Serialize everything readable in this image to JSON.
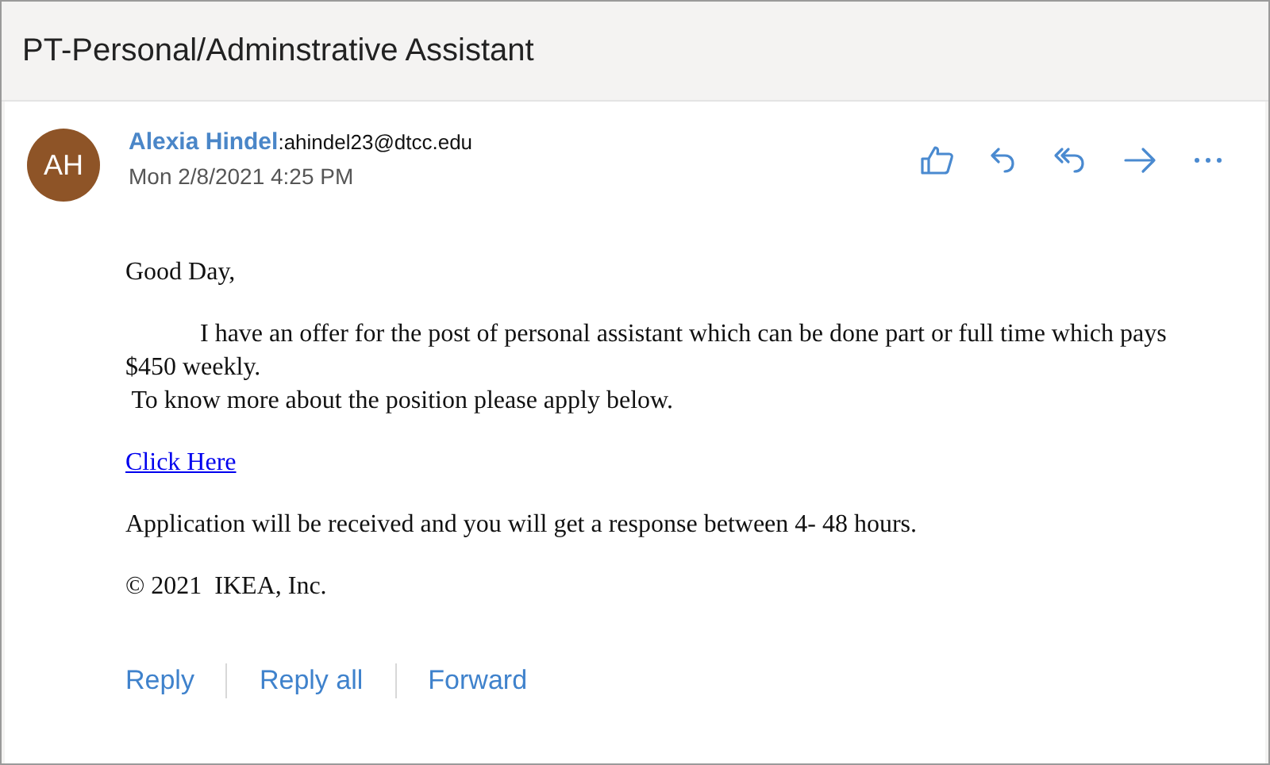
{
  "subject": "PT-Personal/Adminstrative Assistant",
  "sender": {
    "initials": "AH",
    "name": "Alexia Hindel",
    "email": ":ahindel23@dtcc.edu",
    "date": "Mon 2/8/2021 4:25 PM"
  },
  "actions": [
    {
      "kind": "like"
    },
    {
      "kind": "reply"
    },
    {
      "kind": "reply-all"
    },
    {
      "kind": "forward"
    },
    {
      "kind": "more"
    }
  ],
  "body": [
    {
      "kind": "text",
      "text": "Good Day,"
    },
    {
      "kind": "indented",
      "text": "I have an offer for the post of personal assistant which can be done part or full time which pays $450 weekly.",
      "tail": " To know more about the position please apply below."
    },
    {
      "kind": "link",
      "text": "Click Here"
    },
    {
      "kind": "text",
      "text": "Application will be received and you will get a response between 4- 48 hours."
    },
    {
      "kind": "text",
      "text": "© 2021  IKEA, Inc."
    }
  ],
  "footer": [
    "Reply",
    "Reply all",
    "Forward"
  ]
}
